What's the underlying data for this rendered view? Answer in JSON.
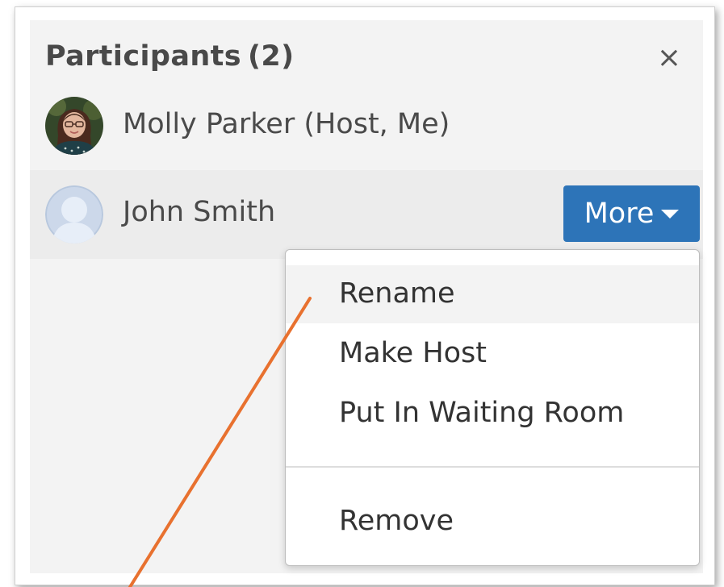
{
  "panel": {
    "title": "Participants",
    "count": "(2)",
    "close_glyph": "×"
  },
  "participants": [
    {
      "name": "Molly Parker (Host, Me)",
      "avatar": "photo"
    },
    {
      "name": "John Smith",
      "avatar": "default-person-icon"
    }
  ],
  "more_button": {
    "label": "More"
  },
  "menu": {
    "items": [
      "Rename",
      "Make Host",
      "Put In Waiting Room",
      "Remove"
    ],
    "highlighted": "Rename"
  },
  "colors": {
    "accent": "#2d74b8",
    "annotation_line": "#e8712f"
  }
}
